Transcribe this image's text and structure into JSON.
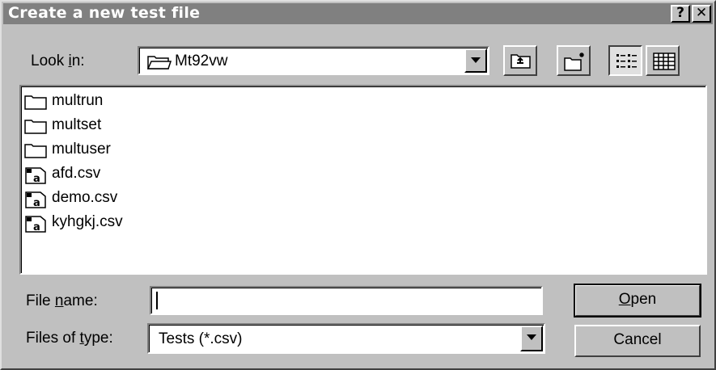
{
  "window": {
    "title": "Create a new test file",
    "help_glyph": "?",
    "close_glyph": "✕"
  },
  "lookin": {
    "label_pre": "Look ",
    "label_key": "i",
    "label_post": "n:",
    "value": "Mt92vw",
    "icon": "folder-open-icon"
  },
  "toolbar": [
    {
      "name": "up-one-level",
      "icon": "up-folder-icon"
    },
    {
      "name": "create-new-folder",
      "icon": "new-folder-icon"
    },
    {
      "name": "list-view",
      "icon": "list-view-icon",
      "pressed": true
    },
    {
      "name": "details-view",
      "icon": "details-view-icon"
    }
  ],
  "files": [
    {
      "name": "multrun",
      "kind": "folder"
    },
    {
      "name": "multset",
      "kind": "folder"
    },
    {
      "name": "multuser",
      "kind": "folder"
    },
    {
      "name": "afd.csv",
      "kind": "csv-file"
    },
    {
      "name": "demo.csv",
      "kind": "csv-file"
    },
    {
      "name": "kyhgkj.csv",
      "kind": "csv-file"
    }
  ],
  "filename": {
    "label_pre": "File ",
    "label_key": "n",
    "label_post": "ame:",
    "value": ""
  },
  "filetype": {
    "label_pre": "Files of ",
    "label_key": "t",
    "label_post": "ype:",
    "value": "Tests (*.csv)"
  },
  "buttons": {
    "open_key": "O",
    "open_rest": "pen",
    "cancel": "Cancel"
  },
  "colors": {
    "titlebar": "#808080",
    "face": "#c0c0c0",
    "window": "#ffffff"
  }
}
